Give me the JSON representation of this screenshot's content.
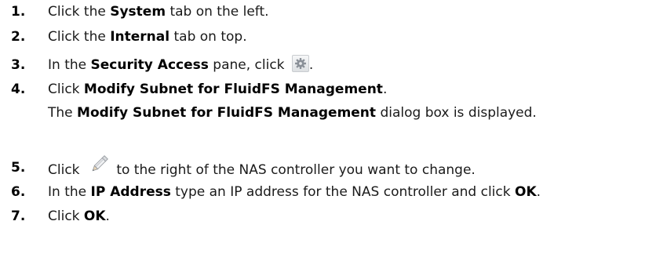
{
  "steps": [
    {
      "number": "1.",
      "before": "Click the ",
      "bold": "System",
      "after": " tab on the left."
    },
    {
      "number": "2.",
      "before": "Click the ",
      "bold": "Internal",
      "after": " tab on top."
    },
    {
      "number": "3.",
      "before": "In the ",
      "bold": "Security Access",
      "middle": " pane, click ",
      "icon": "settings-gear-icon",
      "after": "."
    },
    {
      "number": "4.",
      "before": "Click ",
      "bold": "Modify Subnet for FluidFS Management",
      "after": ".",
      "note_before": "The ",
      "note_bold": "Modify Subnet for FluidFS Management",
      "note_after": " dialog box is displayed."
    },
    {
      "number": "5.",
      "before": "Click ",
      "icon": "pencil-edit-icon",
      "after": " to the right of the NAS controller you want to change."
    },
    {
      "number": "6.",
      "before": "In the ",
      "bold": "IP Address",
      "middle": " type an IP address for the NAS controller and click ",
      "bold2": "OK",
      "after": "."
    },
    {
      "number": "7.",
      "before": "Click ",
      "bold": "OK",
      "after": "."
    }
  ]
}
